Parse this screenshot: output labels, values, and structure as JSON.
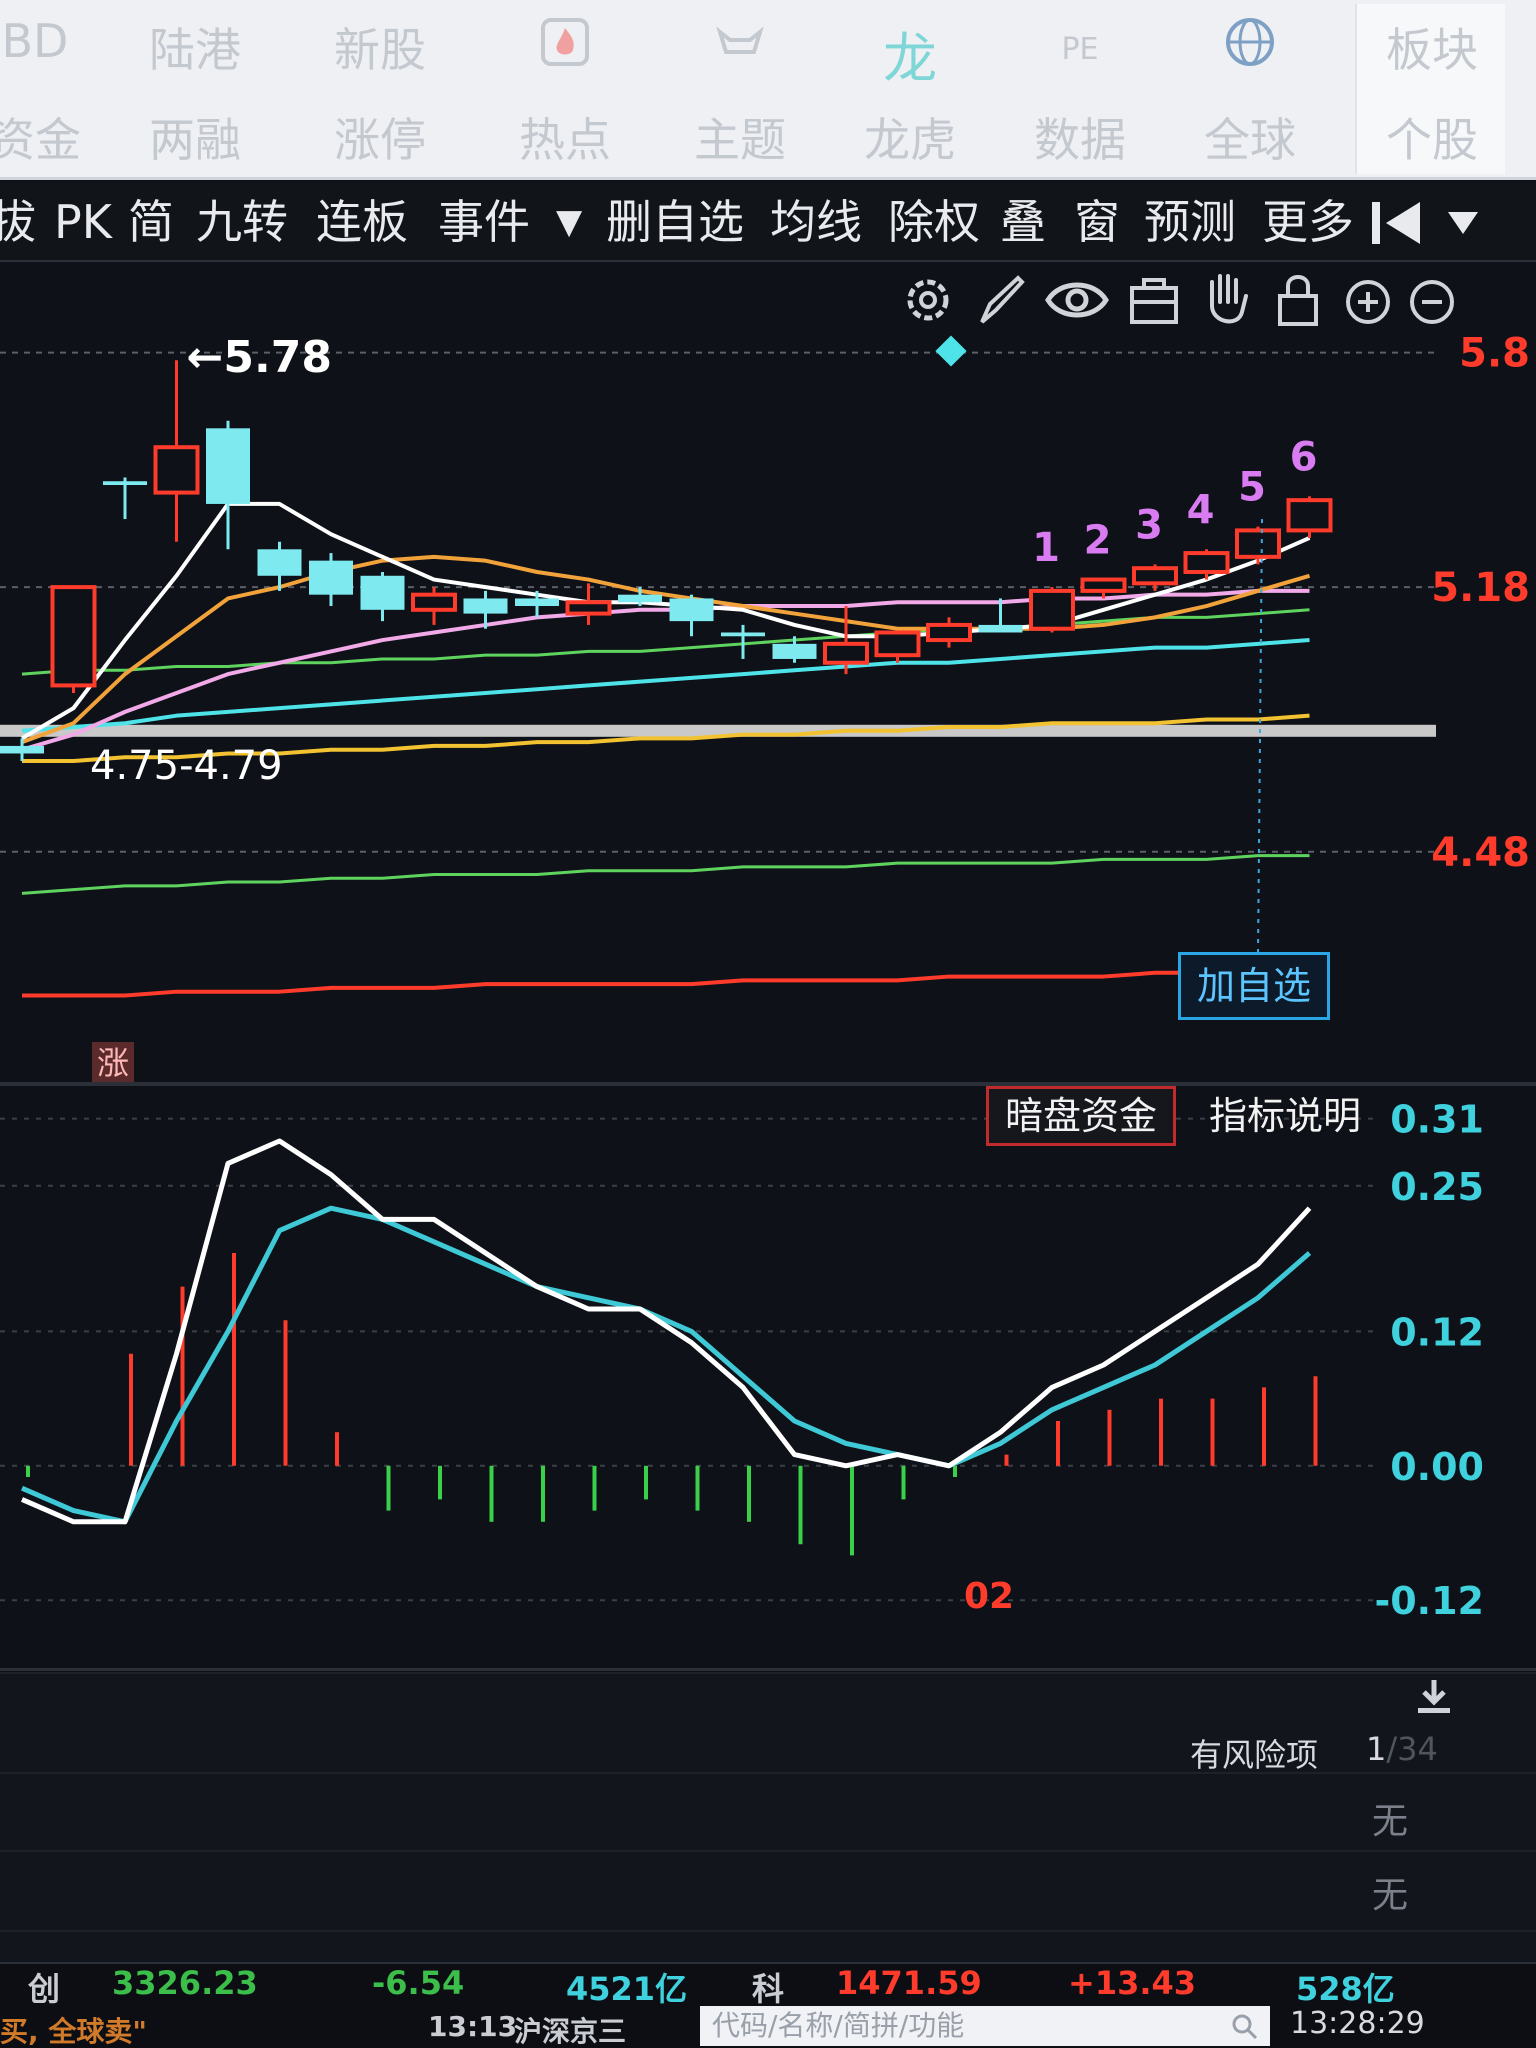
{
  "top_nav": {
    "items": [
      {
        "top": "BD",
        "bottom": "资金"
      },
      {
        "top": "陆港",
        "bottom": "两融"
      },
      {
        "top": "新股",
        "bottom": "涨停"
      },
      {
        "icon": "fire-icon",
        "bottom": "热点"
      },
      {
        "icon": "bull-icon",
        "bottom": "主题"
      },
      {
        "top": "龙",
        "bottom": "龙虎"
      },
      {
        "top": "PE",
        "bottom": "数据"
      },
      {
        "icon": "globe-icon",
        "bottom": "全球"
      },
      {
        "top": "板块",
        "bottom": "个股"
      }
    ]
  },
  "toolbar": {
    "items": [
      "拔",
      "PK",
      "简",
      "九转",
      "连板",
      "事件",
      "▼",
      "删自选",
      "均线",
      "除权",
      "叠",
      "窗",
      "预测",
      "更多"
    ]
  },
  "chart_tools": [
    "gear-icon",
    "pen-icon",
    "eye-icon",
    "briefcase-icon",
    "hand-icon",
    "lock-icon",
    "zoom-in-icon",
    "zoom-out-icon"
  ],
  "main_chart": {
    "high_annotation": "5.78",
    "range_annotation": "4.75-4.79",
    "nine_turn_counts": [
      "1",
      "2",
      "3",
      "4",
      "5",
      "6"
    ],
    "zhang_badge": "涨",
    "add_fav_button": "加自选"
  },
  "macd_panel": {
    "tab_active": "暗盘资金",
    "tab_other": "指标说明",
    "date_label": "02"
  },
  "bottom_panel": {
    "risk_label": "有风险项",
    "risk_count": "1",
    "risk_total": "/34",
    "rows": [
      "无",
      "无"
    ]
  },
  "status_bar": {
    "chuang_label": "创",
    "chuang_value": "3326.23",
    "chuang_change": "-6.54",
    "chuang_amount": "4521亿",
    "ke_label": "科",
    "ke_value": "1471.59",
    "ke_change": "+13.43",
    "ke_amount": "528亿",
    "ticker_left": "买, 全球卖\"",
    "ticker_time": "13:13",
    "ticker_text": "沪深京三",
    "search_placeholder": "代码/名称/简拼/功能",
    "clock": "13:28:29"
  },
  "colors": {
    "up": "#ff3b2b",
    "down": "#7fe9f0",
    "ma5": "#ffffff",
    "ma10": "#f2a23a",
    "ma20": "#f1a9e8",
    "ma30": "#5ed35e",
    "ma60": "#4ee3e8",
    "dif": "#ffffff",
    "dea": "#3fc8d6",
    "accent": "#2aa6e6"
  },
  "chart_data": {
    "type": "candlestick",
    "price_axis_ticks": [
      "5.8",
      "5.18",
      "4.48"
    ],
    "candles": [
      {
        "o": 4.76,
        "h": 4.78,
        "l": 4.72,
        "c": 4.74
      },
      {
        "o": 4.92,
        "h": 5.18,
        "l": 4.9,
        "c": 5.18
      },
      {
        "o": 5.46,
        "h": 5.47,
        "l": 5.36,
        "c": 5.45
      },
      {
        "o": 5.43,
        "h": 5.78,
        "l": 5.3,
        "c": 5.55
      },
      {
        "o": 5.6,
        "h": 5.62,
        "l": 5.28,
        "c": 5.4
      },
      {
        "o": 5.28,
        "h": 5.3,
        "l": 5.17,
        "c": 5.21
      },
      {
        "o": 5.25,
        "h": 5.27,
        "l": 5.13,
        "c": 5.16
      },
      {
        "o": 5.21,
        "h": 5.22,
        "l": 5.09,
        "c": 5.12
      },
      {
        "o": 5.12,
        "h": 5.18,
        "l": 5.08,
        "c": 5.16
      },
      {
        "o": 5.15,
        "h": 5.17,
        "l": 5.07,
        "c": 5.11
      },
      {
        "o": 5.15,
        "h": 5.17,
        "l": 5.1,
        "c": 5.13
      },
      {
        "o": 5.11,
        "h": 5.19,
        "l": 5.08,
        "c": 5.14
      },
      {
        "o": 5.16,
        "h": 5.18,
        "l": 5.13,
        "c": 5.14
      },
      {
        "o": 5.15,
        "h": 5.16,
        "l": 5.05,
        "c": 5.09
      },
      {
        "o": 5.06,
        "h": 5.08,
        "l": 4.99,
        "c": 5.05
      },
      {
        "o": 5.03,
        "h": 5.05,
        "l": 4.98,
        "c": 4.99
      },
      {
        "o": 4.98,
        "h": 5.13,
        "l": 4.95,
        "c": 5.03
      },
      {
        "o": 5.0,
        "h": 5.06,
        "l": 4.98,
        "c": 5.06
      },
      {
        "o": 5.04,
        "h": 5.1,
        "l": 5.02,
        "c": 5.08
      },
      {
        "o": 5.08,
        "h": 5.15,
        "l": 5.06,
        "c": 5.06
      },
      {
        "o": 5.07,
        "h": 5.18,
        "l": 5.06,
        "c": 5.17
      },
      {
        "o": 5.17,
        "h": 5.2,
        "l": 5.15,
        "c": 5.2
      },
      {
        "o": 5.19,
        "h": 5.24,
        "l": 5.17,
        "c": 5.23
      },
      {
        "o": 5.22,
        "h": 5.28,
        "l": 5.2,
        "c": 5.27
      },
      {
        "o": 5.26,
        "h": 5.34,
        "l": 5.24,
        "c": 5.33
      },
      {
        "o": 5.33,
        "h": 5.42,
        "l": 5.31,
        "c": 5.41
      }
    ],
    "ma5": [
      4.78,
      4.86,
      5.04,
      5.21,
      5.4,
      5.4,
      5.32,
      5.26,
      5.2,
      5.18,
      5.16,
      5.14,
      5.14,
      5.13,
      5.12,
      5.08,
      5.05,
      5.05,
      5.06,
      5.07,
      5.08,
      5.12,
      5.16,
      5.2,
      5.25,
      5.31
    ],
    "ma10": [
      4.77,
      4.82,
      4.95,
      5.05,
      5.15,
      5.18,
      5.22,
      5.25,
      5.26,
      5.25,
      5.22,
      5.2,
      5.17,
      5.15,
      5.13,
      5.11,
      5.09,
      5.07,
      5.07,
      5.07,
      5.07,
      5.08,
      5.1,
      5.13,
      5.17,
      5.21
    ],
    "ma20": [
      4.75,
      4.79,
      4.85,
      4.9,
      4.95,
      4.98,
      5.01,
      5.04,
      5.06,
      5.08,
      5.1,
      5.11,
      5.12,
      5.12,
      5.13,
      5.13,
      5.13,
      5.14,
      5.14,
      5.14,
      5.15,
      5.15,
      5.16,
      5.16,
      5.17,
      5.17
    ],
    "ma30": [
      4.95,
      4.96,
      4.96,
      4.97,
      4.97,
      4.98,
      4.98,
      4.99,
      4.99,
      5.0,
      5.0,
      5.01,
      5.01,
      5.02,
      5.03,
      5.04,
      5.05,
      5.06,
      5.07,
      5.07,
      5.08,
      5.09,
      5.1,
      5.1,
      5.11,
      5.12
    ],
    "ma60": [
      4.8,
      4.81,
      4.82,
      4.84,
      4.85,
      4.86,
      4.87,
      4.88,
      4.89,
      4.9,
      4.91,
      4.92,
      4.93,
      4.94,
      4.95,
      4.96,
      4.97,
      4.98,
      4.98,
      4.99,
      5.0,
      5.01,
      5.02,
      5.02,
      5.03,
      5.04
    ],
    "ma120": [
      4.72,
      4.72,
      4.73,
      4.73,
      4.74,
      4.74,
      4.75,
      4.75,
      4.76,
      4.76,
      4.77,
      4.77,
      4.78,
      4.78,
      4.79,
      4.79,
      4.8,
      4.8,
      4.81,
      4.81,
      4.82,
      4.82,
      4.82,
      4.83,
      4.83,
      4.84
    ],
    "ma250": [
      4.37,
      4.38,
      4.39,
      4.39,
      4.4,
      4.4,
      4.41,
      4.41,
      4.42,
      4.42,
      4.42,
      4.43,
      4.43,
      4.43,
      4.44,
      4.44,
      4.44,
      4.45,
      4.45,
      4.45,
      4.45,
      4.46,
      4.46,
      4.46,
      4.47,
      4.47
    ],
    "ma500": [
      4.1,
      4.1,
      4.1,
      4.11,
      4.11,
      4.11,
      4.12,
      4.12,
      4.12,
      4.13,
      4.13,
      4.13,
      4.13,
      4.13,
      4.14,
      4.14,
      4.14,
      4.14,
      4.15,
      4.15,
      4.15,
      4.15,
      4.16,
      4.16,
      4.16,
      4.16
    ],
    "support_line": 4.8,
    "macd": {
      "axis_ticks": [
        "0.31",
        "0.25",
        "0.12",
        "0.00",
        "-0.12"
      ],
      "dif": [
        -0.03,
        -0.05,
        -0.05,
        0.1,
        0.27,
        0.29,
        0.26,
        0.22,
        0.22,
        0.19,
        0.16,
        0.14,
        0.14,
        0.11,
        0.07,
        0.01,
        0.0,
        0.01,
        0.0,
        0.03,
        0.07,
        0.09,
        0.12,
        0.15,
        0.18,
        0.23
      ],
      "dea": [
        -0.02,
        -0.04,
        -0.05,
        0.04,
        0.12,
        0.21,
        0.23,
        0.22,
        0.2,
        0.18,
        0.16,
        0.15,
        0.14,
        0.12,
        0.08,
        0.04,
        0.02,
        0.01,
        0.0,
        0.02,
        0.05,
        0.07,
        0.09,
        0.12,
        0.15,
        0.19
      ],
      "hist": [
        -0.01,
        0.0,
        0.1,
        0.16,
        0.19,
        0.13,
        0.03,
        -0.04,
        -0.03,
        -0.05,
        -0.05,
        -0.04,
        -0.03,
        -0.04,
        -0.05,
        -0.07,
        -0.08,
        -0.03,
        -0.01,
        0.01,
        0.04,
        0.05,
        0.06,
        0.06,
        0.07,
        0.08
      ]
    }
  }
}
